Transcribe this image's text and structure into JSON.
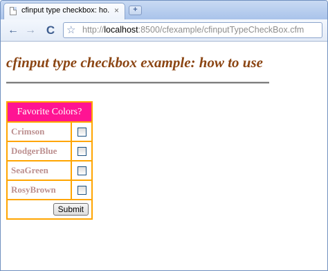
{
  "browser": {
    "tab_title": "cfinput type checkbox: ho...",
    "tab_close": "×",
    "new_tab": "+",
    "back": "←",
    "forward": "→",
    "reload": "C",
    "star": "☆",
    "url_prefix": "http://",
    "url_host": "localhost",
    "url_rest": ":8500/cfexample/cfinputTypeCheckBox.cfm"
  },
  "page": {
    "heading": "cfinput type checkbox example: how to use",
    "table_header": "Favorite Colors?",
    "colors": [
      {
        "label": "Crimson",
        "checked": false
      },
      {
        "label": "DodgerBlue",
        "checked": false
      },
      {
        "label": "SeaGreen",
        "checked": false
      },
      {
        "label": "RosyBrown",
        "checked": false
      }
    ],
    "submit_label": "Submit"
  },
  "theme": {
    "heading_color": "#8b4513",
    "table_border_color": "#ffa500",
    "header_bg": "#ff1493",
    "label_color": "#bc8f8f"
  }
}
